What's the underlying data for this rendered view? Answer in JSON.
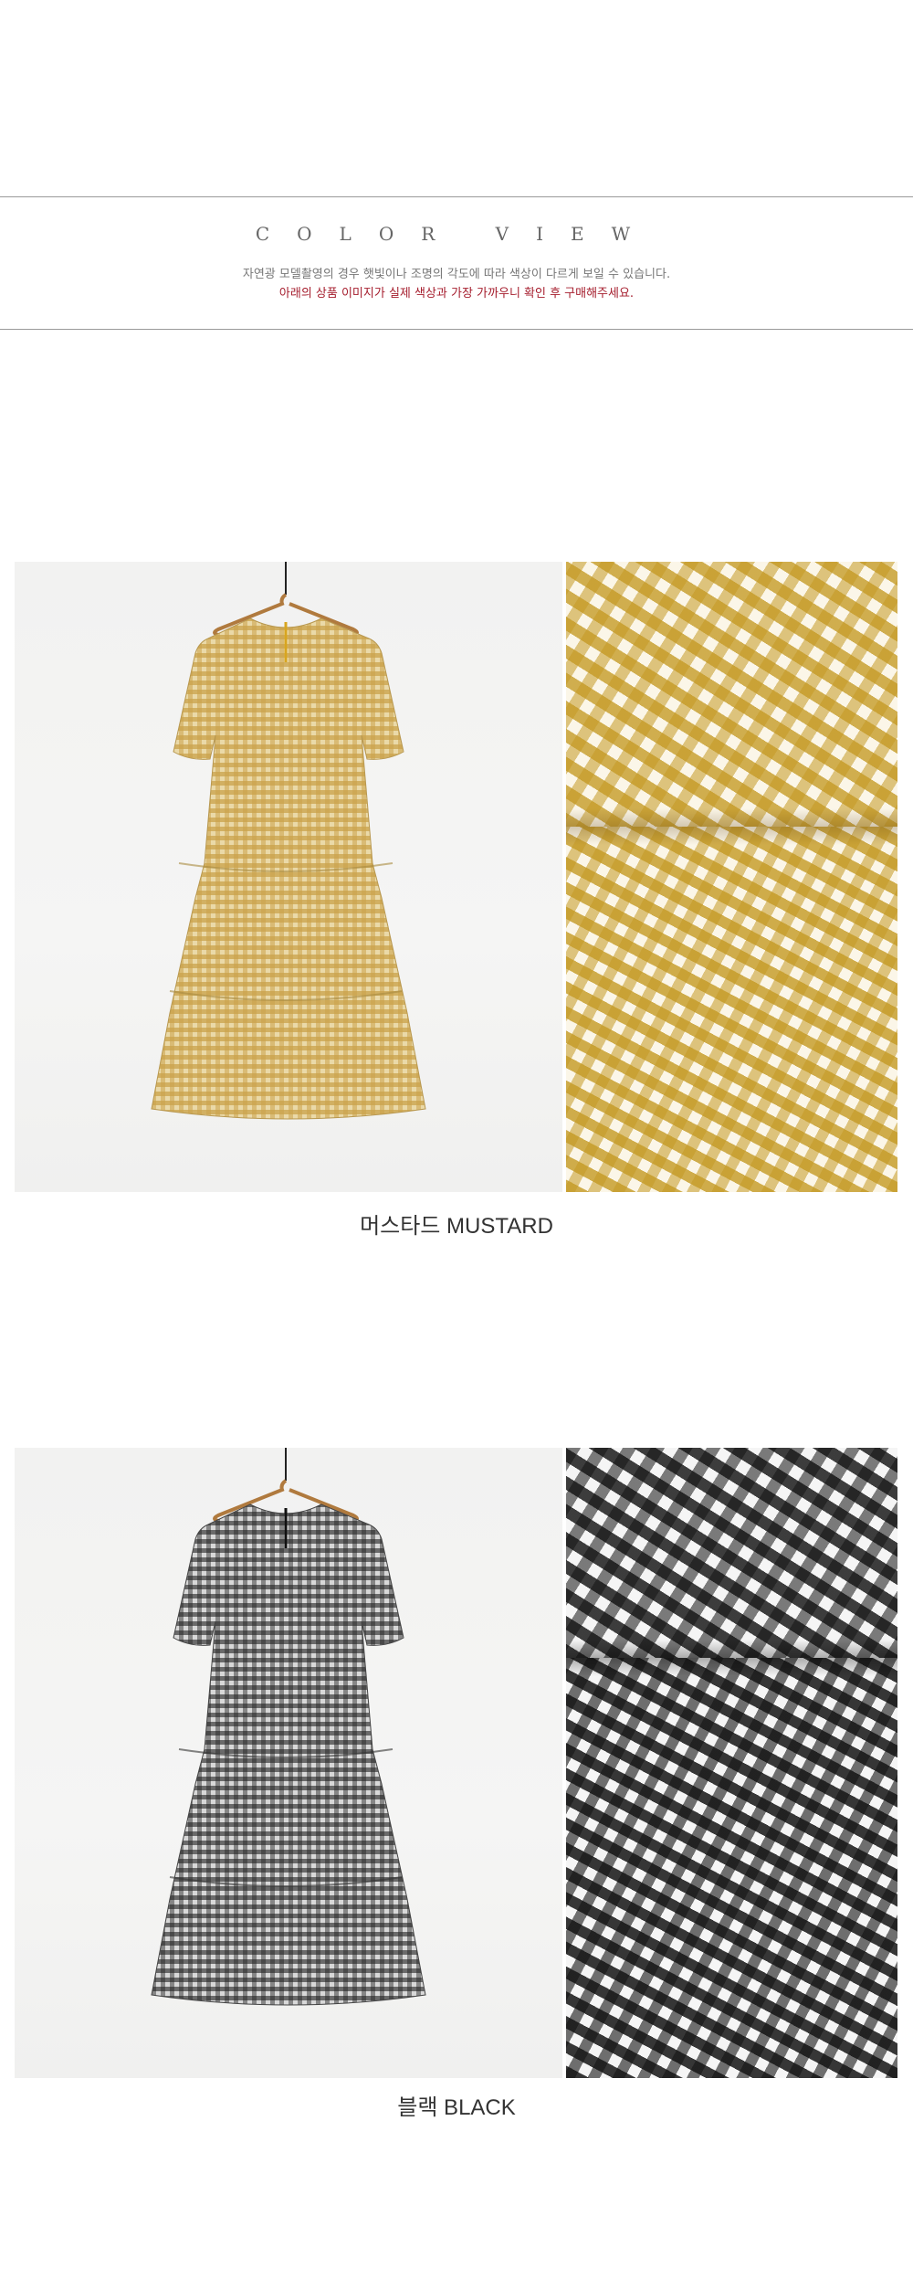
{
  "header": {
    "title": "COLOR VIEW",
    "note_1": "자연광 모델촬영의 경우 햇빛이나 조명의 각도에 따라 색상이 다르게 보일 수 있습니다.",
    "note_2": "아래의 상품 이미지가 실제 색상과 가장 가까우니 확인 후 구매해주세요."
  },
  "colors": [
    {
      "caption": "머스타드 MUSTARD",
      "swatch": "#c4992a"
    },
    {
      "caption": "블랙 BLACK",
      "swatch": "#1a1a1a"
    }
  ],
  "theme": {
    "accent_red": "#a51d2d",
    "rule": "#9a9a9a"
  }
}
